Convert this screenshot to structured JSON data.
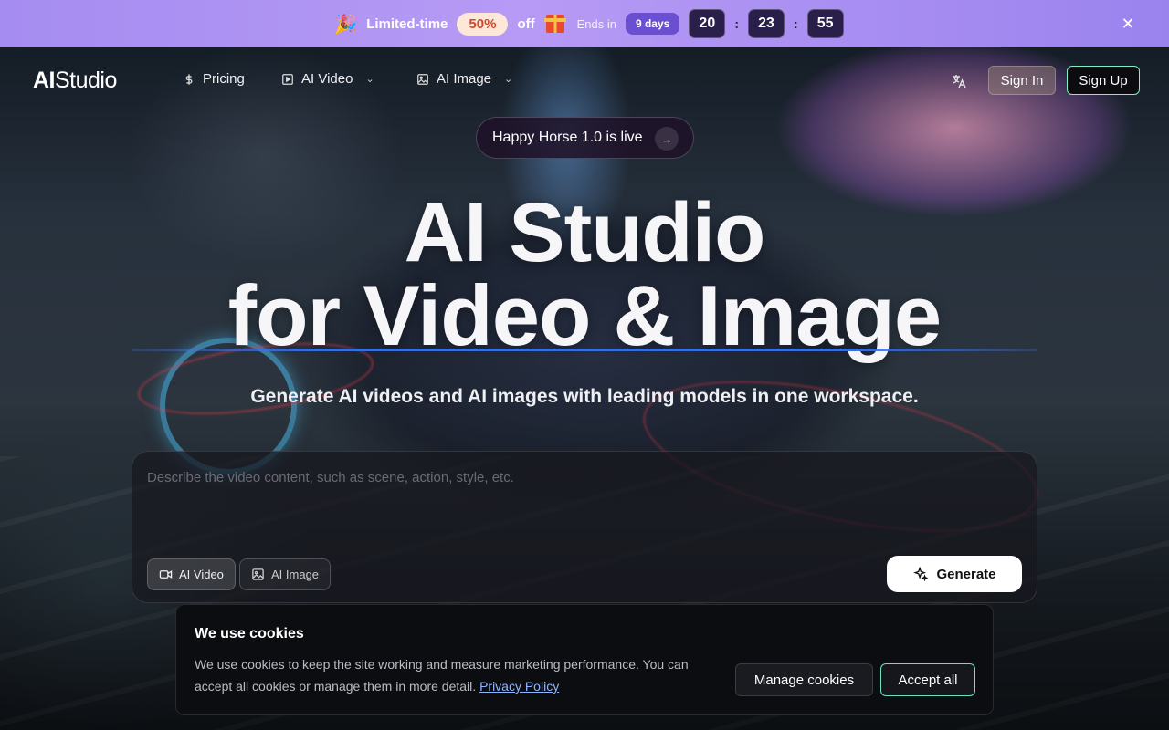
{
  "promo": {
    "label": "Limited-time",
    "discount": "50%",
    "off": "off",
    "ends_in": "Ends in",
    "days": "9 days",
    "hours": "20",
    "minutes": "23",
    "seconds": "55",
    "separator": ":",
    "close_icon": "close-icon"
  },
  "nav": {
    "logo_ai": "AI",
    "logo_studio": "Studio",
    "items": [
      {
        "label": "Pricing",
        "icon": "dollar-icon"
      },
      {
        "label": "AI Video",
        "icon": "video-icon"
      },
      {
        "label": "AI Image",
        "icon": "image-icon"
      }
    ],
    "sign_in": "Sign In",
    "sign_up": "Sign Up"
  },
  "hero": {
    "announcement": "Happy Horse 1.0 is live",
    "title_line1": "AI Studio",
    "title_line2": "for Video & Image",
    "subtitle": "Generate AI videos and AI images with leading models in one workspace."
  },
  "prompt": {
    "placeholder": "Describe the video content, such as scene, action, style, etc.",
    "mode_video": "AI Video",
    "mode_image": "AI Image",
    "generate": "Generate"
  },
  "cookie": {
    "title": "We use cookies",
    "body": "We use cookies to keep the site working and measure marketing performance. You can accept all cookies or manage them in more detail.",
    "policy_link": "Privacy Policy",
    "manage": "Manage cookies",
    "accept": "Accept all"
  },
  "colors": {
    "promo_bg": "#a58cf0",
    "accent_border": "#7ff0c8",
    "underline": "#3b6fd8"
  }
}
